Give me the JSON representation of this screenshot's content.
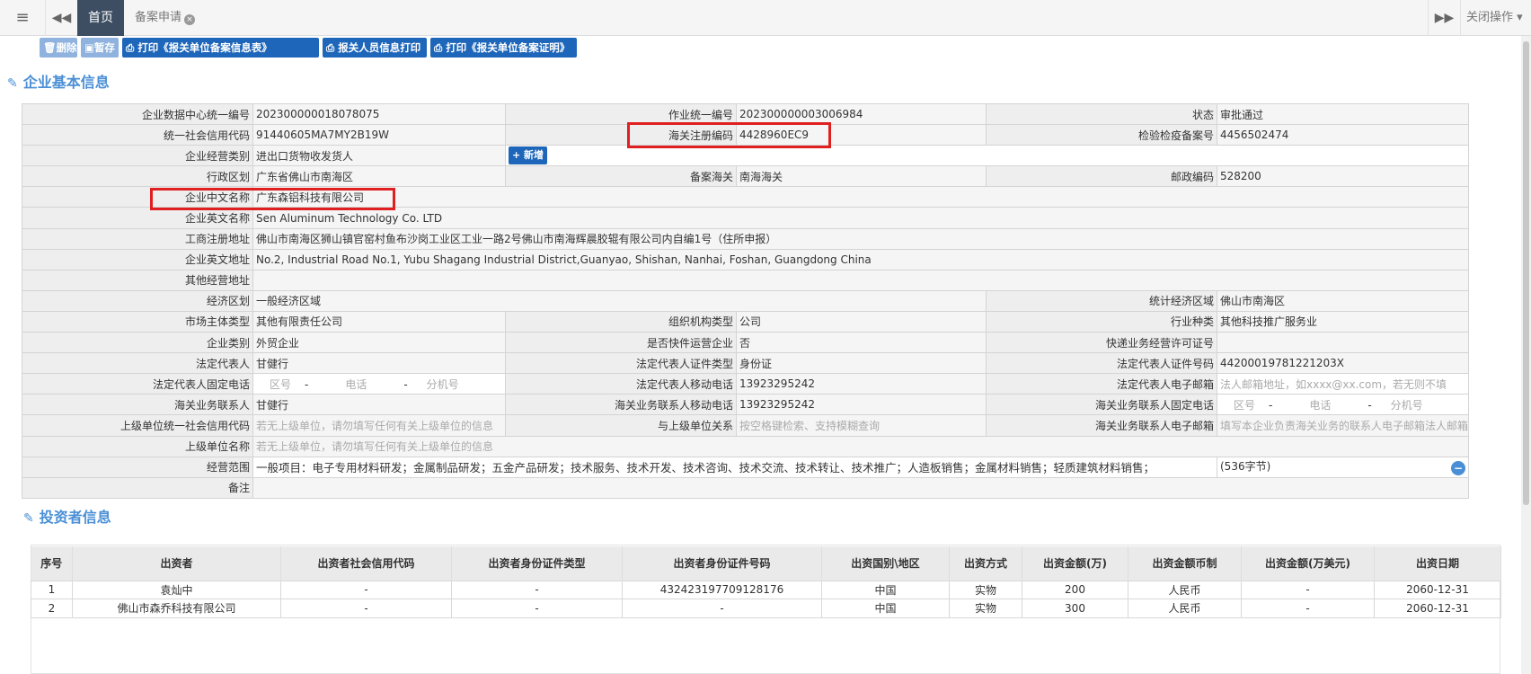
{
  "tabs": {
    "menu_icon": "≡",
    "back_icon": "◀◀",
    "home": "首页",
    "apply": "备案申请",
    "close_icon": "×",
    "forward_icon": "▶▶",
    "close_ops": "关闭操作"
  },
  "toolbar": {
    "delete": "删除",
    "temp_save": "暂存",
    "print_unit_info": "打印《报关单位备案信息表》",
    "print_personnel": "报关人员信息打印",
    "print_unit_cert": "打印《报关单位备案证明》"
  },
  "section1": {
    "icon": "✎",
    "title": "企业基本信息"
  },
  "section2": {
    "icon": "✎",
    "title": "投资者信息"
  },
  "info": {
    "r1": {
      "l1": "企业数据中心统一编号",
      "v1": "202300000018078075",
      "l2": "作业统一编号",
      "v2": "202300000003006984",
      "l3": "状态",
      "v3": "审批通过"
    },
    "r2": {
      "l1": "统一社会信用代码",
      "v1": "91440605MA7MY2B19W",
      "l2": "海关注册编码",
      "v2": "4428960EC9",
      "l3": "检验检疫备案号",
      "v3": "4456502474"
    },
    "r3": {
      "l1": "企业经营类别",
      "v1": "进出口货物收发货人",
      "add": "+ 新增"
    },
    "r4": {
      "l1": "行政区划",
      "v1": "广东省佛山市南海区",
      "l2": "备案海关",
      "v2": "南海海关",
      "l3": "邮政编码",
      "v3": "528200"
    },
    "r5": {
      "l1": "企业中文名称",
      "v1": "广东森铝科技有限公司"
    },
    "r6": {
      "l1": "企业英文名称",
      "v1": "Sen Aluminum Technology Co. LTD"
    },
    "r7": {
      "l1": "工商注册地址",
      "v1": "佛山市南海区狮山镇官窑村鱼布沙岗工业区工业一路2号佛山市南海辉晨胶辊有限公司内自编1号（住所申报）"
    },
    "r8": {
      "l1": "企业英文地址",
      "v1": "No.2, Industrial Road No.1, Yubu Shagang Industrial District,Guanyao, Shishan, Nanhai, Foshan, Guangdong China"
    },
    "r9": {
      "l1": "其他经营地址",
      "v1": ""
    },
    "r10": {
      "l1": "经济区划",
      "v1": "一般经济区域",
      "l3": "统计经济区域",
      "v3": "佛山市南海区"
    },
    "r11": {
      "l1": "市场主体类型",
      "v1": "其他有限责任公司",
      "l2": "组织机构类型",
      "v2": "公司",
      "l3": "行业种类",
      "v3": "其他科技推广服务业"
    },
    "r12": {
      "l1": "企业类别",
      "v1": "外贸企业",
      "l2": "是否快件运营企业",
      "v2": "否",
      "l3": "快递业务经营许可证号",
      "v3": ""
    },
    "r13": {
      "l1": "法定代表人",
      "v1": "甘健行",
      "l2": "法定代表人证件类型",
      "v2": "身份证",
      "l3": "法定代表人证件号码",
      "v3": "44200019781221203X"
    },
    "r14": {
      "l1": "法定代表人固定电话",
      "ph_area": "区号",
      "dash1": "-",
      "ph_tel": "电话",
      "dash2": "-",
      "ph_ext": "分机号",
      "l2": "法定代表人移动电话",
      "v2": "13923295242",
      "l3": "法定代表人电子邮箱",
      "ph3": "法人邮箱地址，如xxxx@xx.com，若无则不填"
    },
    "r15": {
      "l1": "海关业务联系人",
      "v1": "甘健行",
      "l2": "海关业务联系人移动电话",
      "v2": "13923295242",
      "l3": "海关业务联系人固定电话",
      "ph_area": "区号",
      "dash1": "-",
      "ph_tel": "电话",
      "dash2": "-",
      "ph_ext": "分机号"
    },
    "r16": {
      "l1": "上级单位统一社会信用代码",
      "ph1": "若无上级单位，请勿填写任何有关上级单位的信息",
      "l2": "与上级单位关系",
      "ph2": "按空格键检索、支持模糊查询",
      "l3": "海关业务联系人电子邮箱",
      "ph3": "填写本企业负责海关业务的联系人电子邮箱法人邮箱"
    },
    "r17": {
      "l1": "上级单位名称",
      "ph1": "若无上级单位，请勿填写任何有关上级单位的信息"
    },
    "r18": {
      "l1": "经营范围",
      "v1": "一般项目：电子专用材料研发；金属制品研发；五金产品研发；技术服务、技术开发、技术咨询、技术交流、技术转让、技术推广；人造板销售；金属材料销售；轻质建筑材料销售；",
      "bytes": "(536字节)",
      "minus": "−"
    },
    "r19": {
      "l1": "备注",
      "v1": ""
    }
  },
  "investors": {
    "headers": [
      "序号",
      "出资者",
      "出资者社会信用代码",
      "出资者身份证件类型",
      "出资者身份证件号码",
      "出资国别\\地区",
      "出资方式",
      "出资金额(万)",
      "出资金额币制",
      "出资金额(万美元)",
      "出资日期"
    ],
    "rows": [
      [
        "1",
        "袁灿中",
        "-",
        "-",
        "432423197709128176",
        "中国",
        "实物",
        "200",
        "人民币",
        "-",
        "2060-12-31"
      ],
      [
        "2",
        "佛山市森乔科技有限公司",
        "-",
        "-",
        "-",
        "中国",
        "实物",
        "300",
        "人民币",
        "-",
        "2060-12-31"
      ]
    ]
  }
}
